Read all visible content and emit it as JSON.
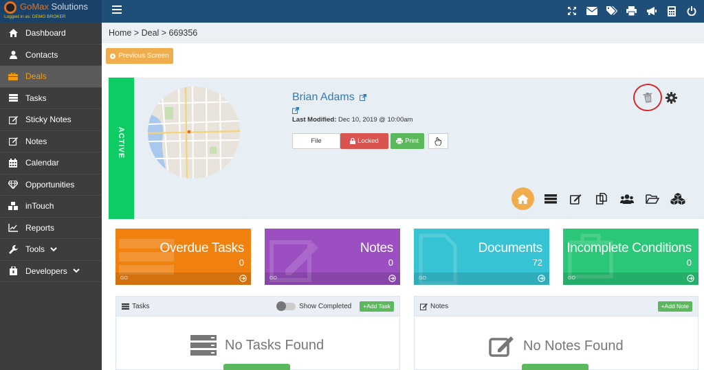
{
  "brand": {
    "name_part1": "GoMax",
    "name_part2": " Solutions",
    "logged_in_label": "Logged in as:",
    "logged_in_user": "DEMO BROKER"
  },
  "sidebar": {
    "items": [
      {
        "label": "Dashboard",
        "icon": "home-icon"
      },
      {
        "label": "Contacts",
        "icon": "user-icon"
      },
      {
        "label": "Deals",
        "icon": "briefcase-icon",
        "active": true
      },
      {
        "label": "Tasks",
        "icon": "tasks-icon"
      },
      {
        "label": "Sticky Notes",
        "icon": "edit-icon"
      },
      {
        "label": "Notes",
        "icon": "edit-icon"
      },
      {
        "label": "Calendar",
        "icon": "calendar-icon"
      },
      {
        "label": "Opportunities",
        "icon": "diamond-icon"
      },
      {
        "label": "inTouch",
        "icon": "cubes-icon"
      },
      {
        "label": "Reports",
        "icon": "line-chart-icon"
      },
      {
        "label": "Tools",
        "icon": "wrench-icon",
        "has_submenu": true
      },
      {
        "label": "Developers",
        "icon": "code-icon",
        "has_submenu": true
      }
    ]
  },
  "breadcrumb": "Home > Deal > 669356",
  "prev_button": "Previous Screen",
  "deal": {
    "status": "ACTIVE",
    "name": "Brian Adams",
    "last_modified_label": "Last Modified:",
    "last_modified_value": "Dec 10, 2019 @ 10:00am",
    "buttons": {
      "file": "File",
      "locked": "Locked",
      "print": "Print"
    }
  },
  "cards": [
    {
      "title": "Overdue Tasks",
      "count": "0",
      "go": "GO",
      "color": "#f0810f"
    },
    {
      "title": "Notes",
      "count": "0",
      "go": "GO",
      "color": "#9b4fc1"
    },
    {
      "title": "Documents",
      "count": "72",
      "go": "GO",
      "color": "#36c4d4"
    },
    {
      "title": "Incomplete Conditions",
      "count": "0",
      "go": "GO",
      "color": "#2bc779"
    }
  ],
  "tasks_panel": {
    "title": "Tasks",
    "toggle_label": "Show Completed",
    "add_label": "Add Task",
    "empty": "No Tasks Found"
  },
  "notes_panel": {
    "title": "Notes",
    "add_label": "Add Note",
    "empty": "No Notes Found"
  },
  "colors": {
    "header": "#1f4e79",
    "sidebar": "#3d3d3d",
    "accent": "#f0ad4e",
    "active_green": "#0dcc63"
  }
}
